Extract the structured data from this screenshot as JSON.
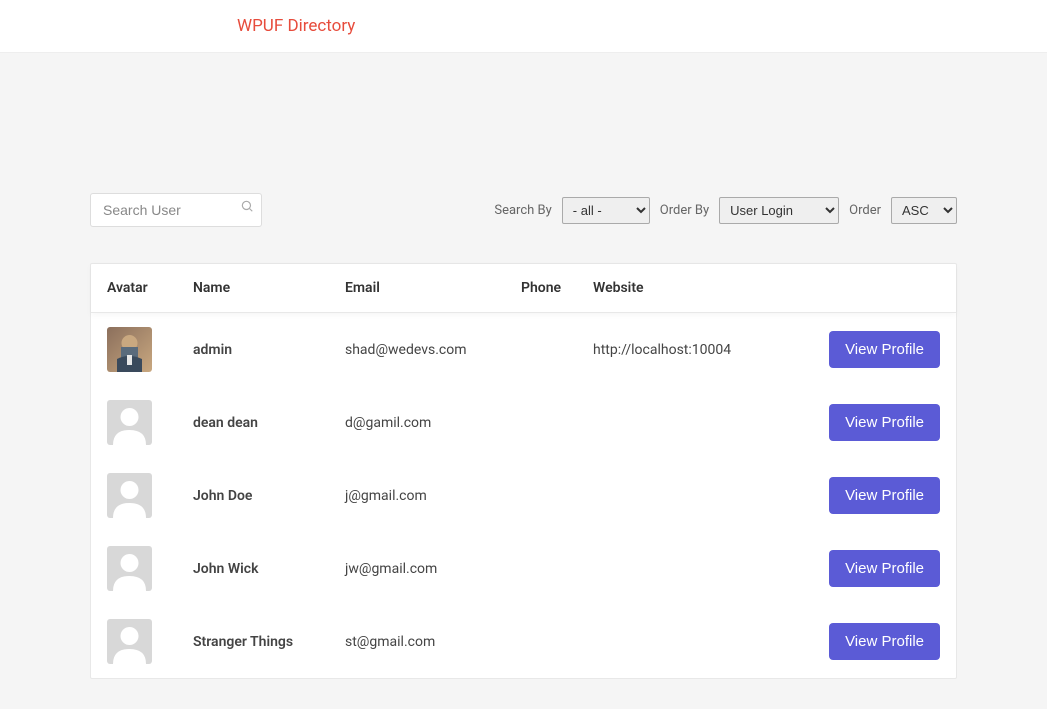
{
  "header": {
    "title": "WPUF Directory"
  },
  "filters": {
    "search_placeholder": "Search User",
    "search_by_label": "Search By",
    "search_by_value": "- all -",
    "order_by_label": "Order By",
    "order_by_value": "User Login",
    "order_label": "Order",
    "order_value": "ASC"
  },
  "table": {
    "headers": {
      "avatar": "Avatar",
      "name": "Name",
      "email": "Email",
      "phone": "Phone",
      "website": "Website"
    },
    "rows": [
      {
        "name": "admin",
        "email": "shad@wedevs.com",
        "phone": "",
        "website": "http://localhost:10004",
        "avatar_type": "real"
      },
      {
        "name": "dean dean",
        "email": "d@gamil.com",
        "phone": "",
        "website": "",
        "avatar_type": "placeholder"
      },
      {
        "name": "John Doe",
        "email": "j@gmail.com",
        "phone": "",
        "website": "",
        "avatar_type": "placeholder"
      },
      {
        "name": "John Wick",
        "email": "jw@gmail.com",
        "phone": "",
        "website": "",
        "avatar_type": "placeholder"
      },
      {
        "name": "Stranger Things",
        "email": "st@gmail.com",
        "phone": "",
        "website": "",
        "avatar_type": "placeholder"
      }
    ],
    "view_profile_label": "View Profile"
  }
}
